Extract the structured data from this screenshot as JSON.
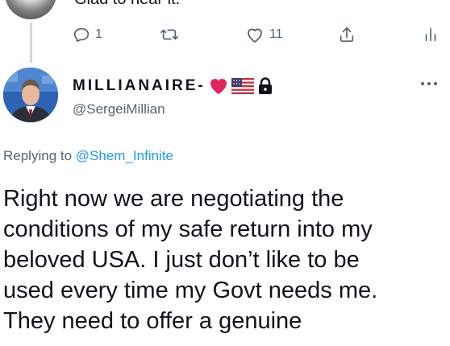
{
  "parent_tweet": {
    "text": "Glad to hear it.",
    "reply_count": "1",
    "like_count": "11"
  },
  "tweet": {
    "display_name": "MILLIANAIRE-",
    "handle": "@SergeiMillian",
    "replying_label": "Replying to",
    "replying_to": "@Shem_Infinite",
    "text_lines": [
      "Right now we are negotiating the",
      "conditions of my safe return into my",
      "beloved USA. I just don’t like to be",
      "used every time my Govt needs me.",
      "They need to offer a genuine"
    ]
  },
  "icons": [
    "reply-icon",
    "retweet-icon",
    "like-icon",
    "share-icon",
    "analytics-icon",
    "heart-emoji",
    "us-flag-emoji",
    "lock-icon",
    "more-icon"
  ],
  "colors": {
    "link": "#1d9bf0",
    "secondary": "#536471",
    "heart": "#e0245e"
  }
}
